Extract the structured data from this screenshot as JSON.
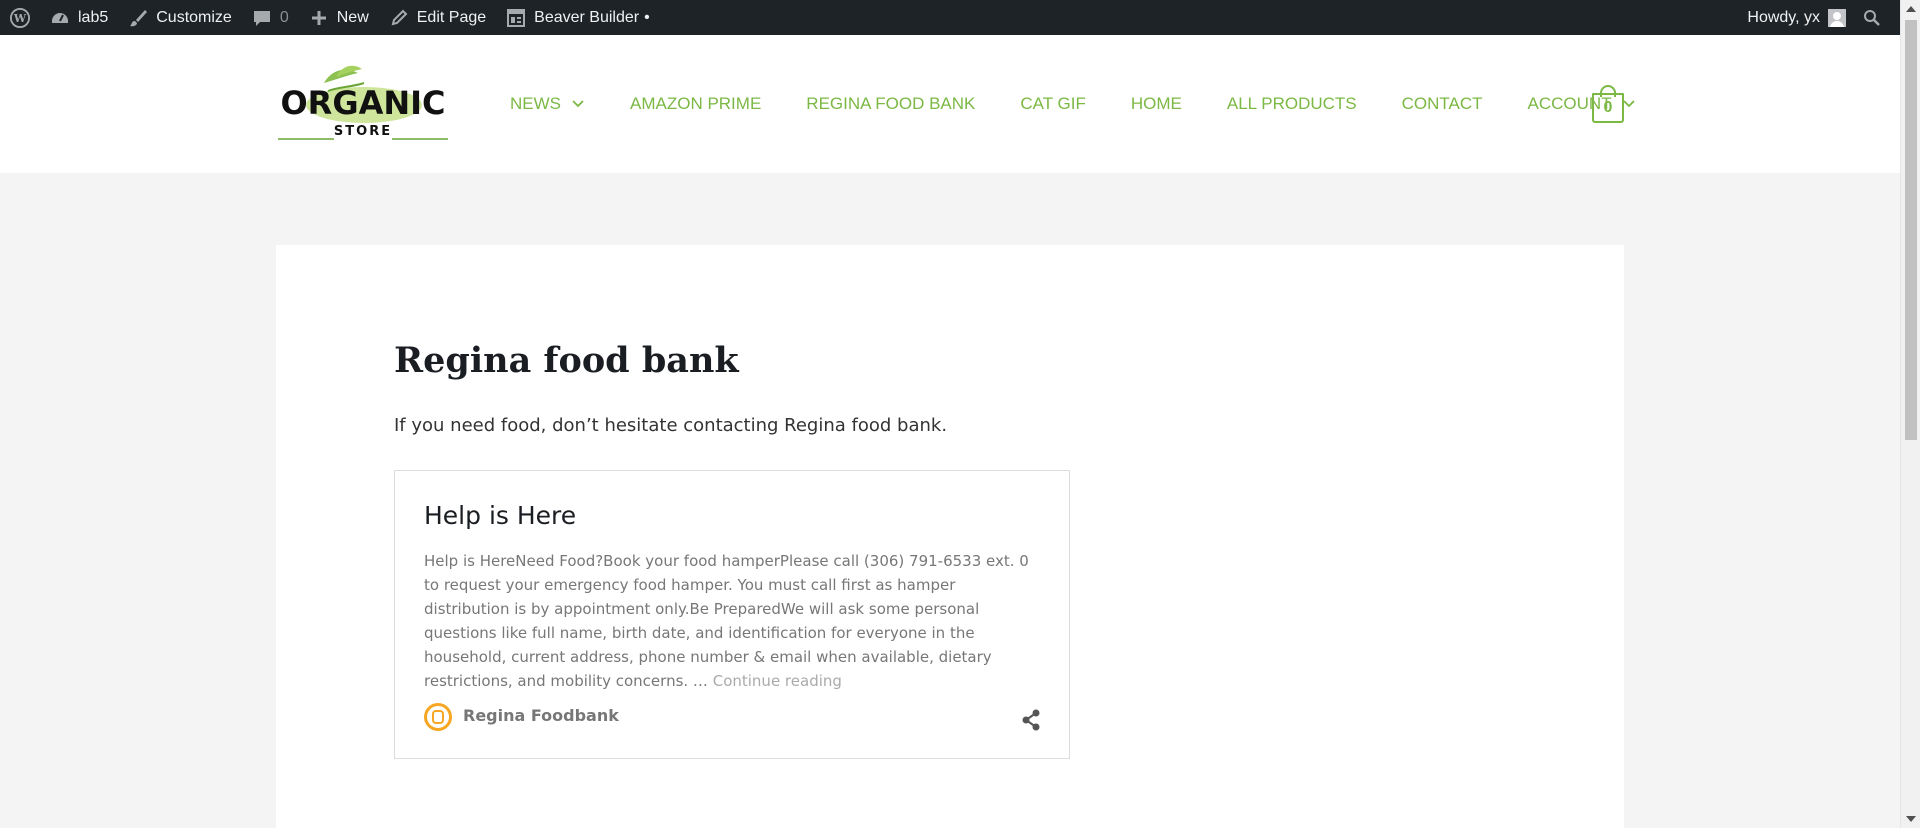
{
  "admin_bar": {
    "site_name": "lab5",
    "customize": "Customize",
    "comments_count": "0",
    "new_label": "New",
    "edit_page": "Edit Page",
    "beaver_builder": "Beaver Builder",
    "beaver_dot": "•",
    "howdy": "Howdy, yx"
  },
  "header": {
    "logo_text_top": "ORGANIC",
    "logo_text_bottom": "STORE",
    "nav": [
      {
        "label": "NEWS",
        "has_dropdown": true
      },
      {
        "label": "AMAZON PRIME"
      },
      {
        "label": "REGINA FOOD BANK"
      },
      {
        "label": "CAT GIF"
      },
      {
        "label": "HOME"
      },
      {
        "label": "ALL PRODUCTS"
      },
      {
        "label": "CONTACT"
      },
      {
        "label": "ACCOUNT",
        "has_dropdown": true
      }
    ],
    "cart_count": "0"
  },
  "page": {
    "title": "Regina food bank",
    "lead": "If you need food, don’t hesitate contacting Regina food bank."
  },
  "embed": {
    "title": "Help is Here",
    "excerpt": "Help is HereNeed Food?Book your food hamperPlease call (306) 791-6533 ext. 0 to request your emergency food hamper. You must call first as hamper distribution is by appointment only.Be PreparedWe will ask some personal questions like full name, birth date, and identification for everyone in the household, current address, phone number & email when available, dietary restrictions, and mobility concerns. …",
    "continue": "Continue reading",
    "site_name": "Regina Foodbank"
  },
  "colors": {
    "accent_green": "#7bb844",
    "admin_bar_bg": "#1d2327",
    "site_icon_orange": "#f6a623"
  }
}
